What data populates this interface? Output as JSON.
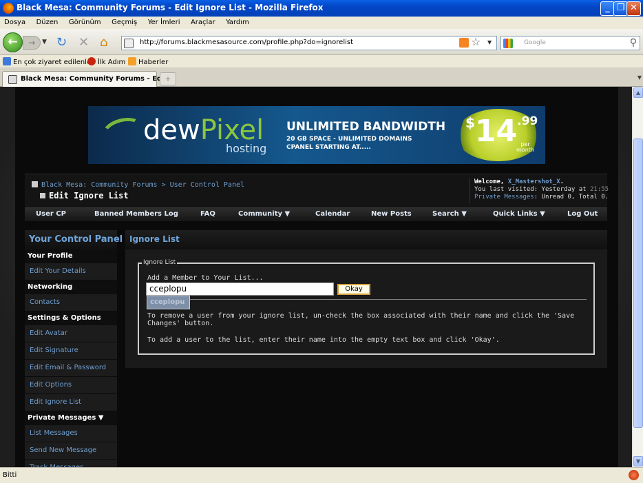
{
  "window": {
    "title": "Black Mesa: Community Forums - Edit Ignore List - Mozilla Firefox",
    "controls": [
      "_",
      "❐",
      "✕"
    ]
  },
  "menu": [
    "Dosya",
    "Düzen",
    "Görünüm",
    "Geçmiş",
    "Yer İmleri",
    "Araçlar",
    "Yardım"
  ],
  "toolbar": {
    "url": "http://forums.blackmesasource.com/profile.php?do=ignorelist",
    "search_placeholder": "Google"
  },
  "bookmarks": [
    "En çok ziyaret edilenler",
    "İlk Adım",
    "Haberler"
  ],
  "tab": {
    "label": "Black Mesa: Community Forums - Edi...",
    "new_tab": "+"
  },
  "banner": {
    "brand_a": "dew",
    "brand_b": "Pixel",
    "brand_sub": "hosting",
    "headline": "UNLIMITED BANDWIDTH",
    "line2": "20 GB SPACE  -  UNLIMITED DOMAINS",
    "line3": "CPANEL STARTING AT.....",
    "price_dollar": "$",
    "price_main": "14",
    "price_cents": ".99",
    "price_per": "per",
    "price_month": "month"
  },
  "header": {
    "breadcrumb": "Black Mesa: Community Forums > User Control Panel",
    "page_title": "Edit Ignore List",
    "welcome_prefix": "Welcome,",
    "username": "X_Mastershot_X",
    "last_visited_prefix": "You last visited: Yesterday at",
    "last_visited_time": "21:55",
    "pm_label": "Private Messages",
    "pm_status": ": Unread 0, Total 0."
  },
  "nav": [
    "User CP",
    "Banned Members Log",
    "FAQ",
    "Community ▼",
    "Calendar",
    "New Posts",
    "Search ▼",
    "Quick Links ▼",
    "Log Out"
  ],
  "sidebar": {
    "title": "Your Control Panel",
    "sections": [
      {
        "heading": "Your Profile",
        "items": [
          "Edit Your Details"
        ]
      },
      {
        "heading": "Networking",
        "items": [
          "Contacts"
        ]
      },
      {
        "heading": "Settings & Options",
        "items": [
          "Edit Avatar",
          "Edit Signature",
          "Edit Email & Password",
          "Edit Options",
          "Edit Ignore List"
        ]
      },
      {
        "heading": "Private Messages ▼",
        "items": [
          "List Messages",
          "Send New Message",
          "Track Messages"
        ]
      }
    ]
  },
  "main": {
    "title": "Ignore List",
    "legend": "Ignore List",
    "add_label": "Add a Member to Your List...",
    "input_value": "cceplopu",
    "okay_label": "Okay",
    "suggestion": "cceplopu",
    "help1": "To remove a user from your ignore list, un-check the box associated with their name and click the 'Save Changes' button.",
    "help2": "To add a user to the list, enter their name into the empty text box and click 'Okay'."
  },
  "status": {
    "text": "Bitti"
  },
  "colors": {
    "link": "#6f9fd1",
    "accent": "#6fa5da",
    "page_bg": "#0a0a0a",
    "xp_blue": "#0346c6"
  }
}
